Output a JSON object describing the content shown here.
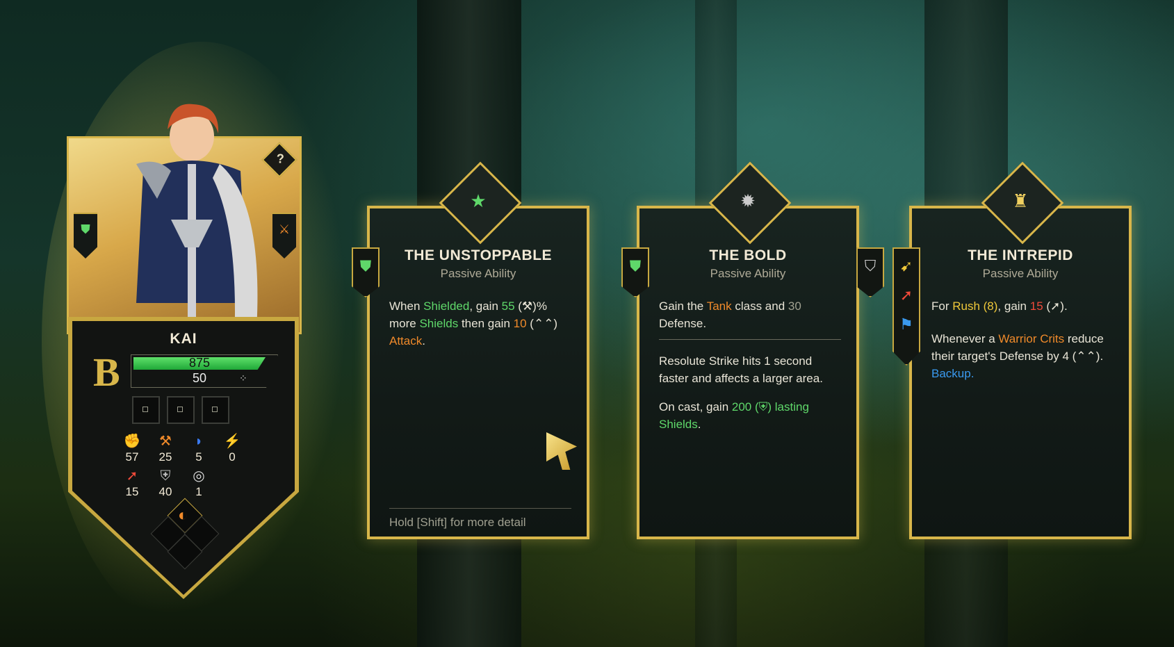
{
  "character": {
    "name": "KAI",
    "grade": "B",
    "hp": "875",
    "mp": "50",
    "help_icon": "?",
    "stats_row1": [
      {
        "icon": "fist-icon",
        "glyph": "✊",
        "value": "57"
      },
      {
        "icon": "hammer-icon",
        "glyph": "⚒",
        "value": "25"
      },
      {
        "icon": "blue-wing-icon",
        "glyph": "◗",
        "value": "5"
      },
      {
        "icon": "sword-speed-icon",
        "glyph": "⚡",
        "value": "0"
      }
    ],
    "stats_row2": [
      {
        "icon": "rush-icon",
        "glyph": "➚",
        "value": "15"
      },
      {
        "icon": "armor-icon",
        "glyph": "⛨",
        "value": "40"
      },
      {
        "icon": "target-icon",
        "glyph": "◎",
        "value": "1"
      }
    ]
  },
  "abilities": [
    {
      "title": "THE UNSTOPPABLE",
      "subtitle": "Passive Ability",
      "emblem": "star-banner-icon",
      "body": {
        "t1": "When ",
        "kw1": "Shielded",
        "t2": ", gain ",
        "n1": "55",
        "t3": " (⚒)%",
        "t4": "more ",
        "kw2": "Shields",
        "t5": " then gain ",
        "n2": "10",
        "t6": " (⌃⌃)",
        "kw3": "Attack",
        "t7": "."
      },
      "hint": "Hold [Shift] for more detail"
    },
    {
      "title": "THE BOLD",
      "subtitle": "Passive Ability",
      "emblem": "crab-icon",
      "body": {
        "p1a": "Gain the ",
        "p1kw": "Tank",
        "p1b": " class and ",
        "p1n": "30",
        "p1c": " Defense.",
        "p2": "Resolute Strike hits 1 second faster and affects a larger area.",
        "p3a": "On cast, gain ",
        "p3n": "200",
        "p3b": " (⛨) lasting",
        "p3kw": "Shields",
        "p3c": "."
      }
    },
    {
      "title": "THE INTREPID",
      "subtitle": "Passive Ability",
      "emblem": "tower-icon",
      "body": {
        "p1a": "For ",
        "p1kw": "Rush (8)",
        "p1b": ", gain ",
        "p1n": "15",
        "p1c": " (➚).",
        "p2a": "Whenever a ",
        "p2kw": "Warrior Crits",
        "p2b": " reduce their target's ",
        "p2c": "Defense by 4 (⌃⌃).",
        "p2link": "Backup."
      }
    }
  ]
}
